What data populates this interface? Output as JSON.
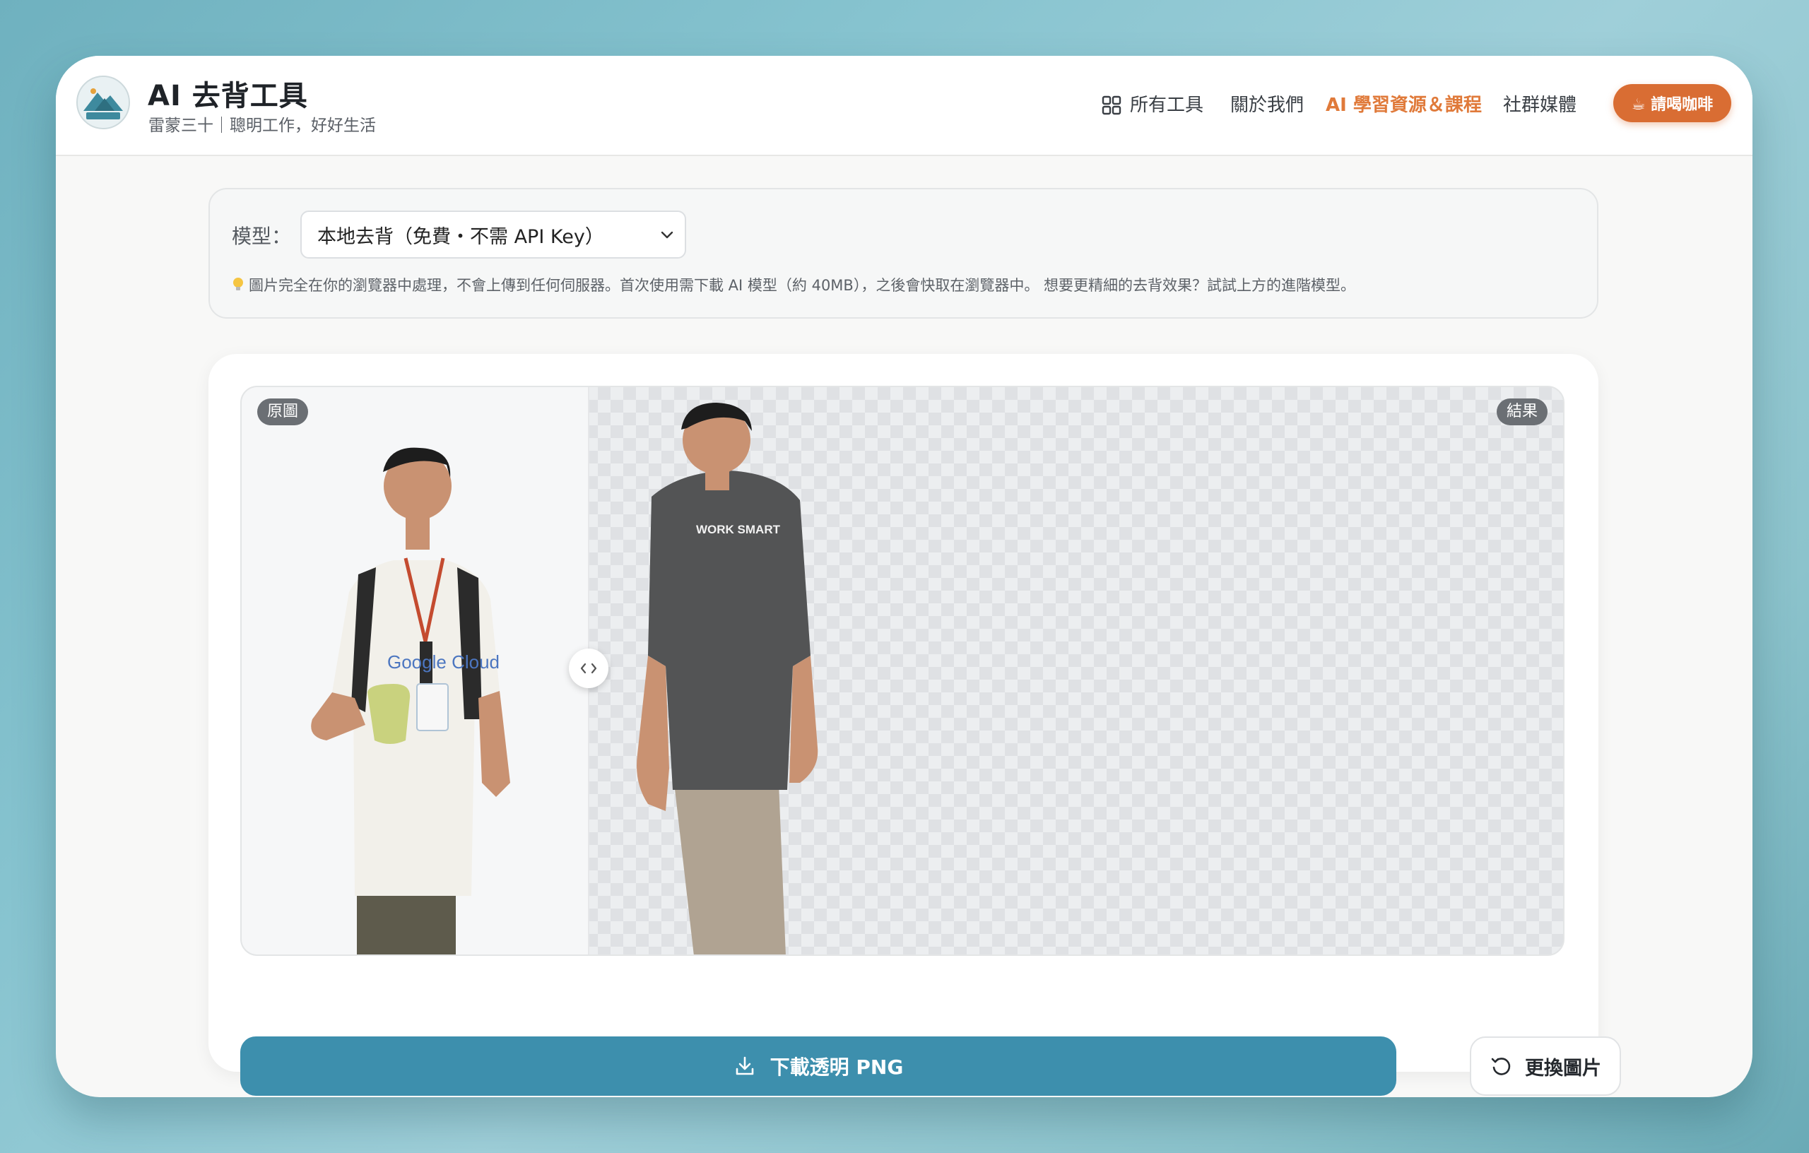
{
  "header": {
    "title": "AI 去背工具",
    "subtitle": "雷蒙三十｜聰明工作，好好生活",
    "logo_text": "雷蒙三十",
    "nav": {
      "all_tools": "所有工具",
      "about": "關於我們",
      "ai_learning": "AI 學習資源＆課程",
      "social": "社群媒體"
    },
    "coffee_button": "☕ 請喝咖啡"
  },
  "settings": {
    "model_label": "模型：",
    "model_selected": "本地去背（免費・不需 API Key）",
    "tip": "圖片完全在你的瀏覽器中處理，不會上傳到任何伺服器。首次使用需下載 AI 模型（約 40MB），之後會快取在瀏覽器中。 想要更精細的去背效果？試試上方的進階模型。"
  },
  "preview": {
    "original_badge": "原圖",
    "result_badge": "結果",
    "shirt_left_text": "Google Cloud",
    "shirt_right_text": "WORK SMART",
    "slider_position": 0.26
  },
  "actions": {
    "download": "下載透明 PNG",
    "replace": "更換圖片"
  },
  "colors": {
    "accent_orange": "#d96d33",
    "nav_highlight": "#e07a3a",
    "primary_teal": "#3d8fad"
  }
}
